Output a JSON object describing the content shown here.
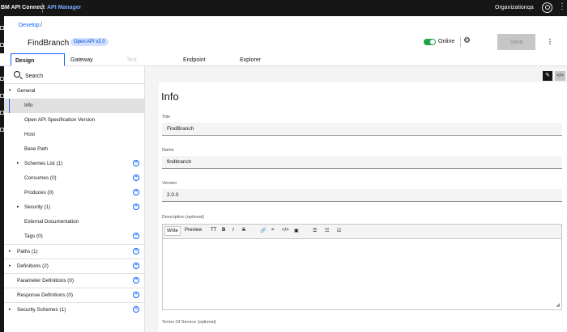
{
  "topbar": {
    "brand": "BM API Connect",
    "product": "API Manager",
    "org_label": "Organization:",
    "user": "qa"
  },
  "header": {
    "breadcrumb": "Develop",
    "breadcrumb_sep": "/",
    "title": "FindBranch",
    "spec_tag": "Open API v2.0",
    "status": "Online",
    "save_label": "Save"
  },
  "tabs": [
    "Design",
    "Gateway",
    "Test",
    "Endpoint",
    "Explorer"
  ],
  "sidebar": {
    "search_placeholder": "Search",
    "items": [
      {
        "label": "General"
      },
      {
        "label": "Info"
      },
      {
        "label": "Open API Specification Version"
      },
      {
        "label": "Host"
      },
      {
        "label": "Base Path"
      },
      {
        "label": "Schemes List (1)"
      },
      {
        "label": "Consumes (0)"
      },
      {
        "label": "Produces (0)"
      },
      {
        "label": "Security (1)"
      },
      {
        "label": "External Documentation"
      },
      {
        "label": "Tags (0)"
      },
      {
        "label": "Paths (1)"
      },
      {
        "label": "Definitions (2)"
      },
      {
        "label": "Parameter Definitions (0)"
      },
      {
        "label": "Response Definitions (0)"
      },
      {
        "label": "Security Schemes (1)"
      }
    ]
  },
  "panel": {
    "title": "Info",
    "fields": {
      "title_label": "Title",
      "title_value": "FindBranch",
      "name_label": "Name",
      "name_value": "findbranch",
      "version_label": "Version",
      "version_value": "2.0.0",
      "description_label": "Description (optional)",
      "tos_label": "Terms Of Service (optional)"
    },
    "editor": {
      "write": "Write",
      "preview": "Preview",
      "tt": "TT",
      "bold": "B",
      "italic": "I",
      "strike": "S",
      "quote": "❝",
      "code": "</>"
    }
  },
  "colors": {
    "accent": "#0f62fe",
    "topbar_bg": "#161616",
    "online": "#24a148"
  }
}
